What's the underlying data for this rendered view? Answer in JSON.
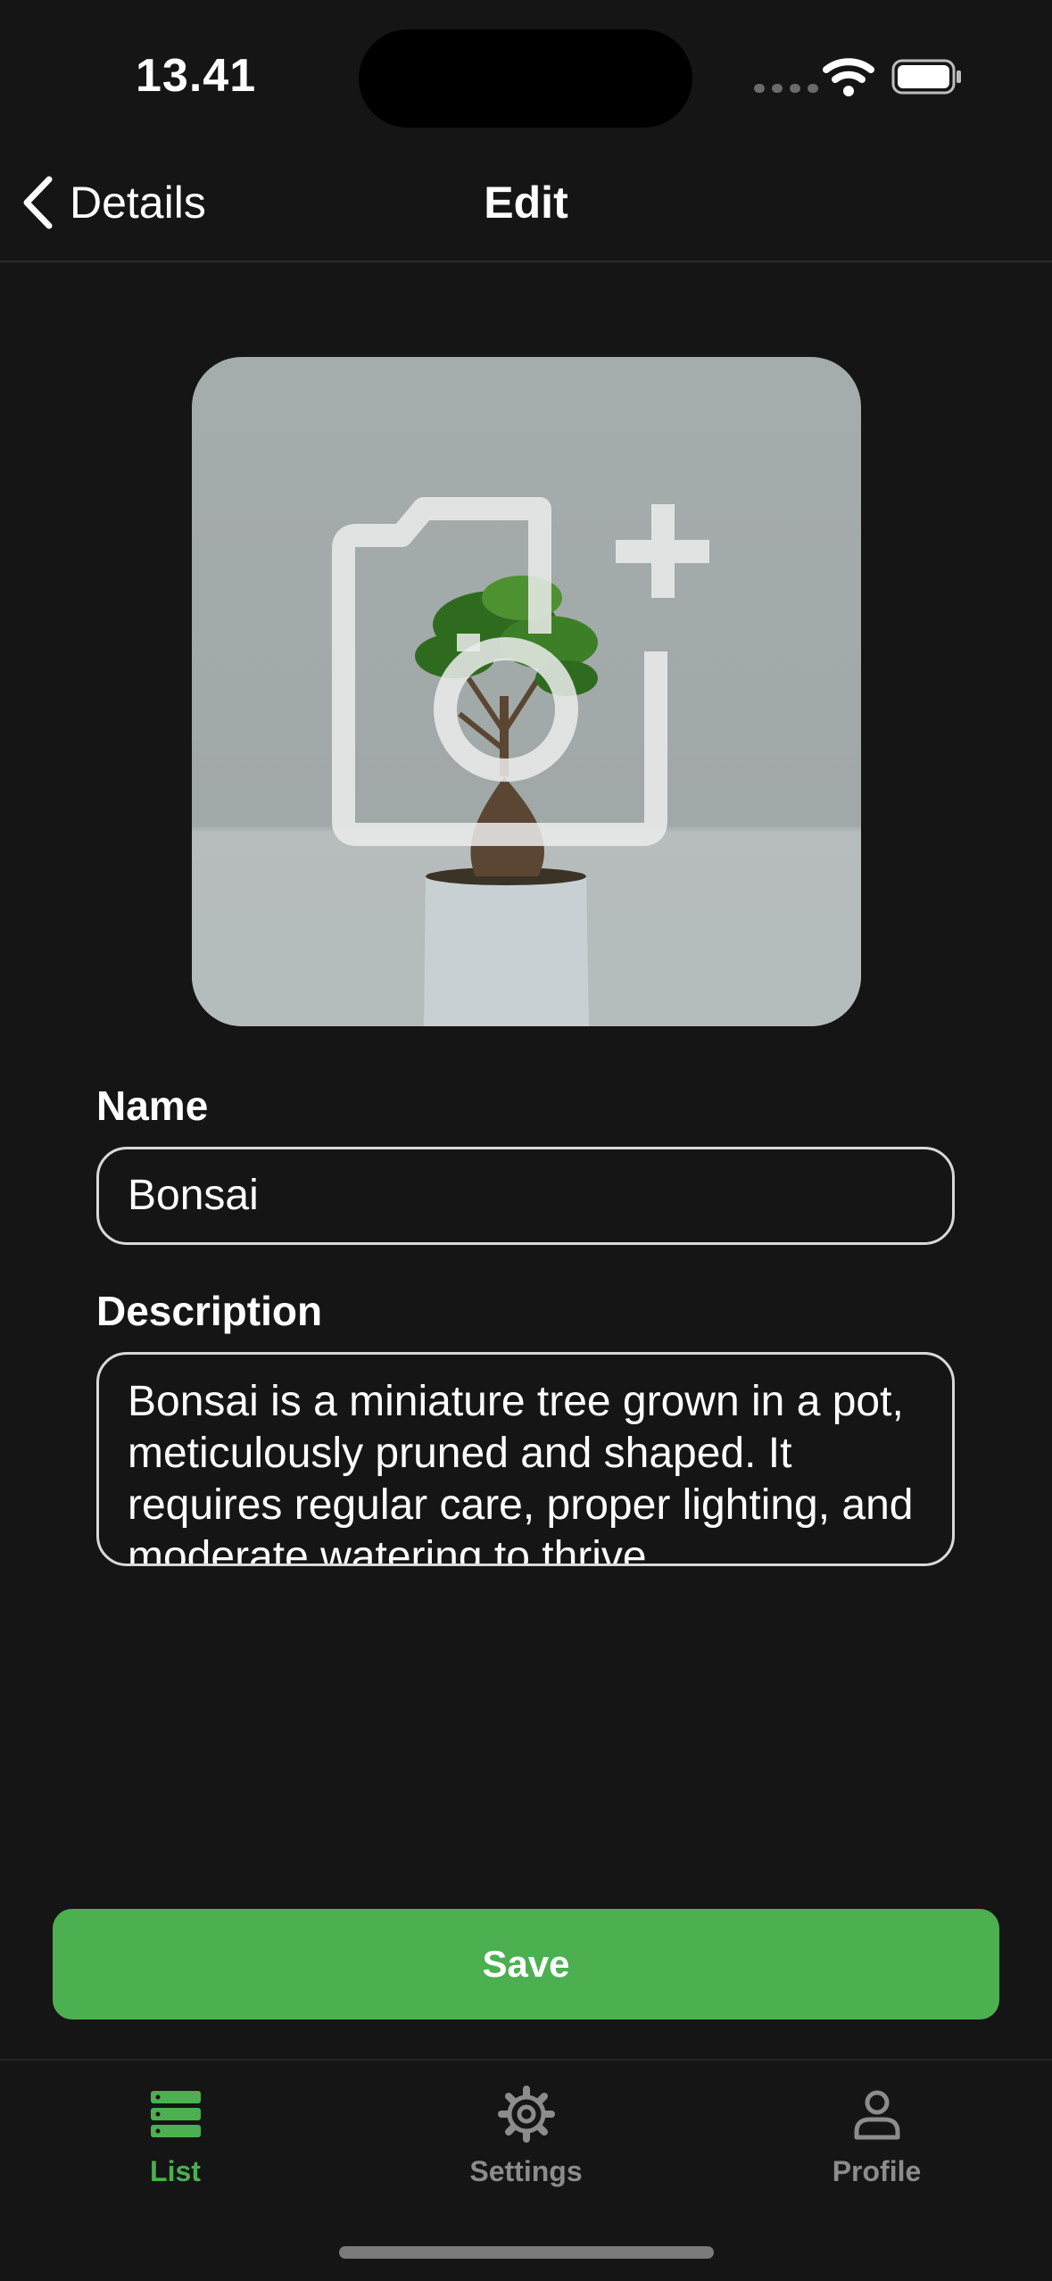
{
  "status_bar": {
    "time": "13.41"
  },
  "nav": {
    "back_label": "Details",
    "title": "Edit"
  },
  "photo": {
    "icon": "add-photo-icon"
  },
  "form": {
    "name_label": "Name",
    "name_value": "Bonsai",
    "description_label": "Description",
    "description_value": "Bonsai is a miniature tree grown in a pot, meticulously pruned and shaped. It requires regular care, proper lighting, and moderate watering to thrive."
  },
  "actions": {
    "save_label": "Save"
  },
  "tabs": [
    {
      "label": "List",
      "icon": "list-icon",
      "active": true
    },
    {
      "label": "Settings",
      "icon": "gear-icon",
      "active": false
    },
    {
      "label": "Profile",
      "icon": "person-icon",
      "active": false
    }
  ],
  "colors": {
    "accent": "#4caf50",
    "background": "#151515",
    "inactive_tab": "#8c8c8c"
  }
}
